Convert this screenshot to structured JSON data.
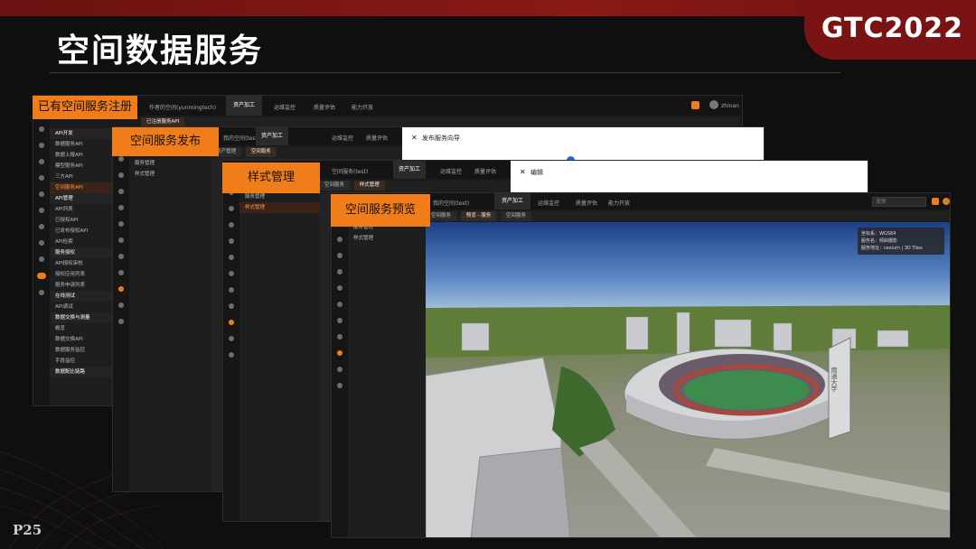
{
  "slide": {
    "title": "空间数据服务",
    "logo": "GTC2022",
    "page_number": "P25"
  },
  "callouts": {
    "register": "已有空间服务注册",
    "publish": "空间服务发布",
    "style": "样式管理",
    "preview": "空间服务预览"
  },
  "win1": {
    "user": "作者的空间(yunmingtech)",
    "nav": [
      "资产加工",
      "运维监控",
      "质量评估",
      "能力开放"
    ],
    "tab": "已注册服务API",
    "avatar_name": "zhinan",
    "sidebar": [
      {
        "label": "API开发",
        "type": "hd"
      },
      {
        "label": "数据服务API",
        "type": "it"
      },
      {
        "label": "数据上报API",
        "type": "it"
      },
      {
        "label": "模型服务API",
        "type": "it"
      },
      {
        "label": "三方API",
        "type": "it"
      },
      {
        "label": "空间服务API",
        "type": "sel"
      },
      {
        "label": "API管理",
        "type": "hd"
      },
      {
        "label": "API列表",
        "type": "it"
      },
      {
        "label": "已授权API",
        "type": "it"
      },
      {
        "label": "已发布授权API",
        "type": "it"
      },
      {
        "label": "API检索",
        "type": "it"
      },
      {
        "label": "服务授权",
        "type": "hd"
      },
      {
        "label": "API授权审核",
        "type": "it"
      },
      {
        "label": "授权应用列表",
        "type": "it"
      },
      {
        "label": "服务申请列表",
        "type": "it"
      },
      {
        "label": "在线测试",
        "type": "hd"
      },
      {
        "label": "API调试",
        "type": "it"
      },
      {
        "label": "数据交换与测量",
        "type": "hd"
      },
      {
        "label": "概览",
        "type": "it"
      },
      {
        "label": "数据交换API",
        "type": "it"
      },
      {
        "label": "数据服务监控",
        "type": "it"
      },
      {
        "label": "手段监控",
        "type": "it"
      },
      {
        "label": "数据配比链路",
        "type": "hd"
      }
    ]
  },
  "win2": {
    "user": "我的空间(test)",
    "nav": [
      "资产加工",
      "运维监控",
      "质量评估"
    ],
    "tabs": [
      "资产管理",
      "空间服务"
    ],
    "sidebar": [
      "服务管理",
      "样式管理"
    ],
    "dialog_title": "发布服务向导"
  },
  "win3": {
    "user": "空间服务(test)",
    "nav": [
      "资产加工",
      "运维监控",
      "质量评估"
    ],
    "tabs": [
      "空间服务",
      "样式管理"
    ],
    "sidebar": [
      "服务管理",
      "样式管理"
    ],
    "dialog_title": "编辑"
  },
  "win4": {
    "user": "我的空间(test)",
    "nav": [
      "资产加工",
      "运维监控",
      "质量评估",
      "能力开放"
    ],
    "tabs": [
      "空间服务",
      "预览 - 服务",
      "空间服务"
    ],
    "sidebar": [
      "服务管理",
      "样式管理"
    ],
    "search_placeholder": "搜索",
    "info_lines": [
      "坐标系：WGS84",
      "服务名：倾斜摄影",
      "服务地址：cesium | 3D Tiles"
    ],
    "scene_sign": "南通大学"
  },
  "colors": {
    "accent": "#f07d1a",
    "brand_red": "#7a1414"
  }
}
